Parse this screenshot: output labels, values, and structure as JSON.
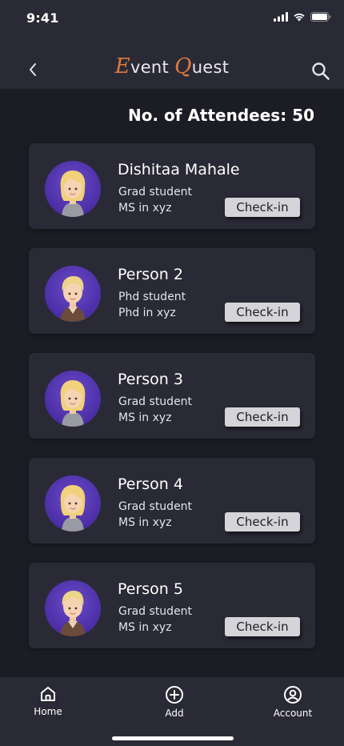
{
  "status_bar": {
    "time": "9:41"
  },
  "header": {
    "title_first_cap": "E",
    "title_first_rest": "vent ",
    "title_second_cap": "Q",
    "title_second_rest": "uest"
  },
  "attendees": {
    "count_label": "No. of Attendees: 50"
  },
  "cards": [
    {
      "name": "Dishitaa Mahale",
      "line1": "Grad student",
      "line2": "MS in xyz",
      "button": "Check-in",
      "avatar": "girl-avatar"
    },
    {
      "name": "Person 2",
      "line1": "Phd student",
      "line2": "Phd in xyz",
      "button": "Check-in",
      "avatar": "boy-avatar"
    },
    {
      "name": "Person 3",
      "line1": "Grad student",
      "line2": "MS in xyz",
      "button": "Check-in",
      "avatar": "girl-avatar"
    },
    {
      "name": "Person 4",
      "line1": "Grad student",
      "line2": "MS in xyz",
      "button": "Check-in",
      "avatar": "girl-avatar"
    },
    {
      "name": "Person 5",
      "line1": "Grad student",
      "line2": "MS in xyz",
      "button": "Check-in",
      "avatar": "boy-avatar"
    }
  ],
  "nav": {
    "home": "Home",
    "add": "Add",
    "account": "Account"
  },
  "colors": {
    "background": "#1c1c25",
    "surface": "#2a2a36",
    "accent": "#e07a3a",
    "avatar_bg": "#4b2ea6",
    "button": "#d5d5d9"
  }
}
